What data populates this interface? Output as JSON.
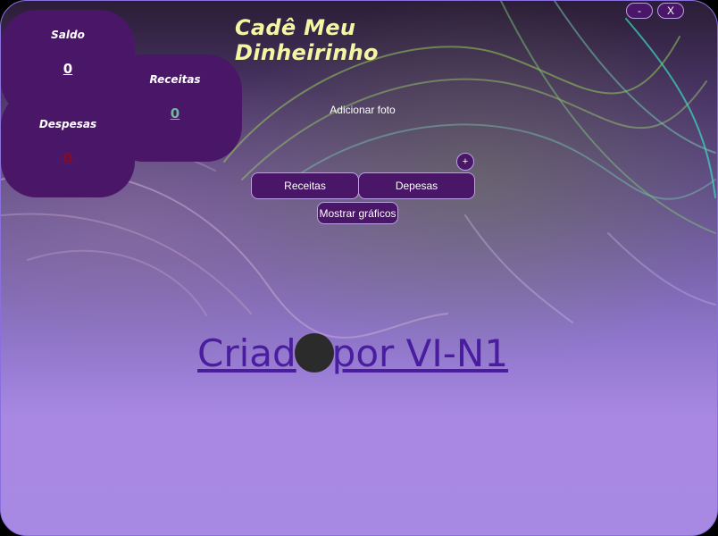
{
  "app": {
    "title": "Cadê Meu Dinheirinho"
  },
  "window": {
    "minimize_label": "-",
    "close_label": "X"
  },
  "cards": {
    "saldo": {
      "label": "Saldo",
      "value": "0",
      "color": "#ffffff"
    },
    "receitas": {
      "label": "Receitas",
      "value": "0",
      "color": "#6fb89a"
    },
    "despesas": {
      "label": "Despesas",
      "value": "0",
      "color": "#8b0a1e"
    }
  },
  "photo": {
    "add_label": "Adicionar foto",
    "plus_label": "+"
  },
  "actions": {
    "receitas_label": "Receitas",
    "despesas_label": "Depesas",
    "charts_label": "Mostrar gráficos"
  },
  "credit": {
    "text_before": "Criad",
    "text_after": "por VI-N1",
    "icon": "github-icon"
  },
  "colors": {
    "accent": "#4a1668",
    "title": "#f4f6a6",
    "link": "#4a1d9e"
  }
}
